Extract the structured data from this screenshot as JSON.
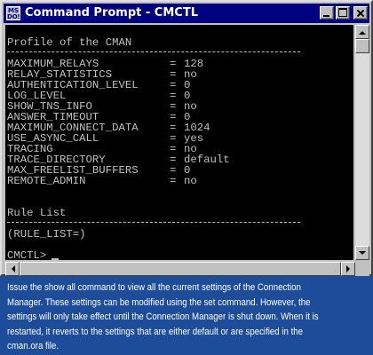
{
  "window": {
    "title": "Command Prompt - CMCTL",
    "app_icon_text": "MS DOS"
  },
  "console": {
    "heading": "Profile of the CMAN",
    "separator": "-----------------------------------------------",
    "settings": [
      {
        "name": "MAXIMUM_RELAYS",
        "value": "128"
      },
      {
        "name": "RELAY_STATISTICS",
        "value": "no"
      },
      {
        "name": "AUTHENTICATION_LEVEL",
        "value": "0"
      },
      {
        "name": "LOG_LEVEL",
        "value": "0"
      },
      {
        "name": "SHOW_TNS_INFO",
        "value": "no"
      },
      {
        "name": "ANSWER_TIMEOUT",
        "value": "0"
      },
      {
        "name": "MAXIMUM_CONNECT_DATA",
        "value": "1024"
      },
      {
        "name": "USE_ASYNC_CALL",
        "value": "yes"
      },
      {
        "name": "TRACING",
        "value": "no"
      },
      {
        "name": "TRACE_DIRECTORY",
        "value": "default"
      },
      {
        "name": "MAX_FREELIST_BUFFERS",
        "value": "0"
      },
      {
        "name": "REMOTE_ADMIN",
        "value": "no"
      }
    ],
    "rule_heading": "Rule List",
    "rule_list": "(RULE_LIST=)",
    "prompt": "CMCTL>"
  },
  "icons": [
    "minimize-icon",
    "maximize-icon",
    "close-icon",
    "scroll-up-icon",
    "scroll-down-icon",
    "scroll-left-icon",
    "scroll-right-icon"
  ],
  "caption": "Issue the show all command to view all the current settings of the Connection Manager. These settings can be modified using the set command. However, the settings will only take effect until the Connection Manager is shut down. When it is restarted, it reverts to the settings that are either default or are specified in the cman.ora file.",
  "colors": {
    "title_bar": "#000080",
    "console_bg": "#000000",
    "console_text": "#c0c0c0",
    "caption_bg": "#1d4c9b"
  }
}
